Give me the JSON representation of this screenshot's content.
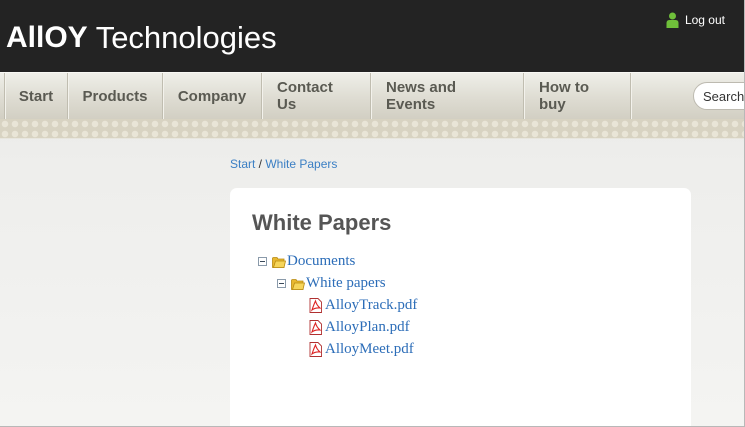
{
  "header": {
    "logo_alloy": "AllOY",
    "logo_tech": "Technologies",
    "logout_label": "Log out"
  },
  "nav": {
    "items": [
      "Start",
      "Products",
      "Company",
      "Contact Us",
      "News and Events",
      "How to buy"
    ],
    "search_placeholder": "Search"
  },
  "breadcrumb": {
    "home": "Start",
    "separator": " / ",
    "current": "White Papers"
  },
  "main": {
    "title": "White Papers",
    "tree": {
      "root": "Documents",
      "folder": "White papers",
      "files": [
        "AlloyTrack.pdf",
        "AlloyPlan.pdf",
        "AlloyMeet.pdf"
      ]
    }
  },
  "colors": {
    "header_bg": "#232323",
    "link": "#2c6db8",
    "logout_icon": "#6fbf3a"
  }
}
